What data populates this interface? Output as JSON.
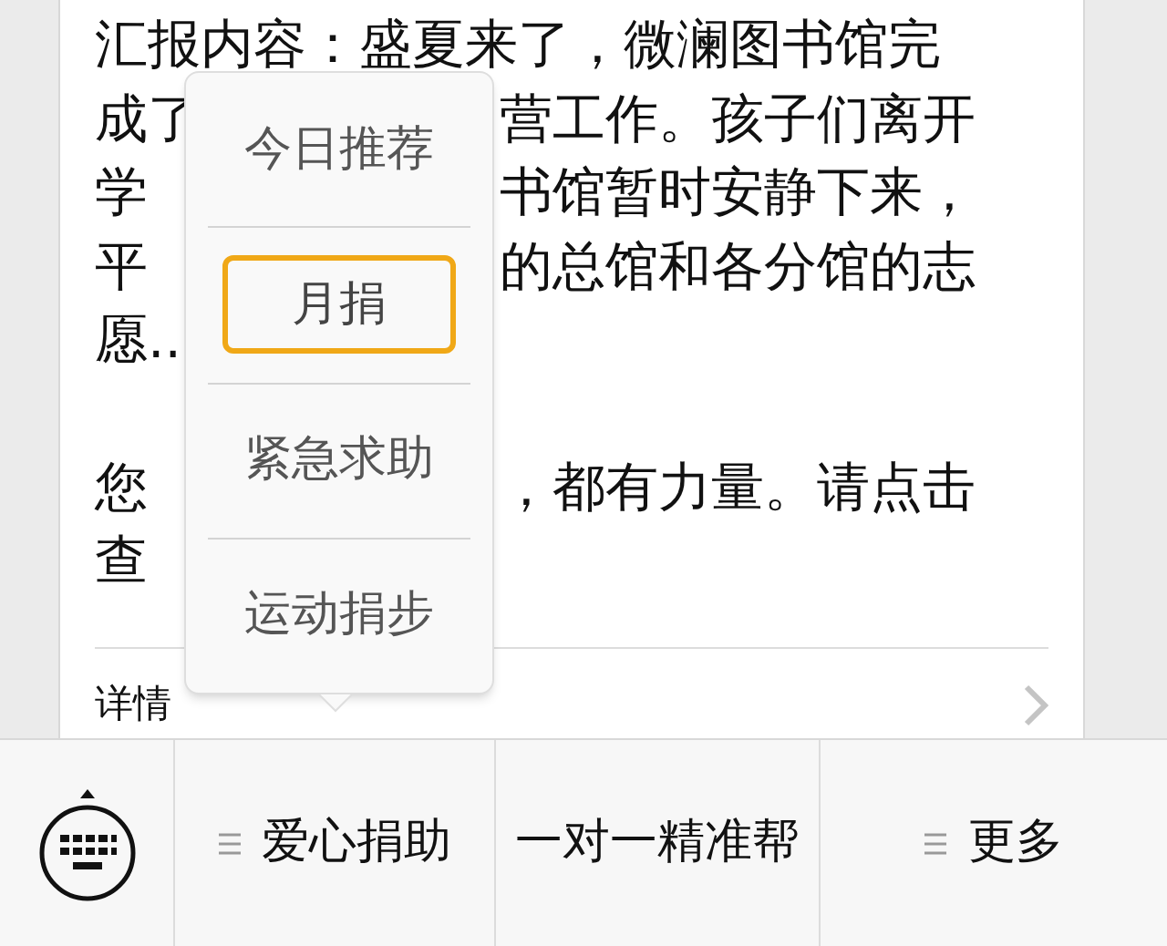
{
  "report": {
    "paragraphs": [
      {
        "lines": [
          {
            "left": "汇报内容：盛夏来了，微澜图书馆完"
          },
          {
            "left": "成了",
            "right": "营工作。孩子们离开"
          },
          {
            "left": "学",
            "right": "书馆暂时安静下来，"
          },
          {
            "left": "平",
            "right": "的总馆和各分馆的志"
          },
          {
            "left": "愿.."
          }
        ]
      },
      {
        "lines": [
          {
            "left": "您",
            "right": "，都有力量。请点击"
          },
          {
            "left": "查"
          }
        ]
      }
    ],
    "details_link": "详情"
  },
  "popup_menu": {
    "items": [
      {
        "label": "今日推荐",
        "selected": false
      },
      {
        "label": "月捐",
        "selected": true
      },
      {
        "label": "紧急求助",
        "selected": false
      },
      {
        "label": "运动捐步",
        "selected": false
      }
    ]
  },
  "bottom_menu": [
    {
      "label": "爱心捐助",
      "has_submenu": true
    },
    {
      "label": "一对一精准帮",
      "has_submenu": false
    },
    {
      "label": "更多",
      "has_submenu": true
    }
  ]
}
